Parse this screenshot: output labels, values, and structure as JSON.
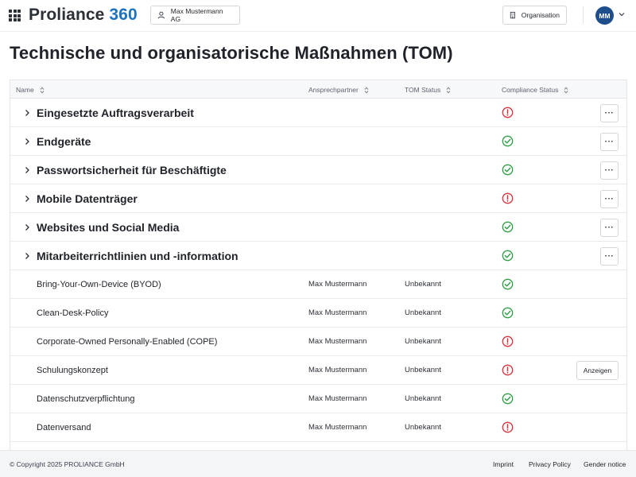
{
  "header": {
    "brand_name": "Proliance",
    "brand_suffix": "360",
    "tenant_label": "Max Mustermann AG",
    "org_label": "Organisation",
    "avatar_initials": "MM"
  },
  "page": {
    "title": "Technische und organisatorische Maßnahmen (TOM)"
  },
  "table": {
    "columns": {
      "name": "Name",
      "contact": "Ansprechpartner",
      "tom_status": "TOM Status",
      "compliance": "Compliance Status"
    },
    "more_label": "···",
    "view_label": "Anzeigen",
    "groups": [
      {
        "name": "Eingesetzte Auftragsverarbeit",
        "compliance": "warning"
      },
      {
        "name": "Endgeräte",
        "compliance": "ok"
      },
      {
        "name": "Passwortsicherheit für Beschäftigte",
        "compliance": "ok"
      },
      {
        "name": "Mobile Datenträger",
        "compliance": "warning"
      },
      {
        "name": "Websites und Social Media",
        "compliance": "ok"
      },
      {
        "name": "Mitarbeiterrichtlinien und -information",
        "compliance": "ok"
      }
    ],
    "items": [
      {
        "name": "Bring-Your-Own-Device (BYOD)",
        "contact": "Max Mustermann",
        "tom_status": "Unbekannt",
        "compliance": "ok"
      },
      {
        "name": "Clean-Desk-Policy",
        "contact": "Max Mustermann",
        "tom_status": "Unbekannt",
        "compliance": "ok"
      },
      {
        "name": "Corporate-Owned Personally-Enabled (COPE)",
        "contact": "Max Mustermann",
        "tom_status": "Unbekannt",
        "compliance": "warning"
      },
      {
        "name": "Schulungskonzept",
        "contact": "Max Mustermann",
        "tom_status": "Unbekannt",
        "compliance": "warning"
      },
      {
        "name": "Datenschutzverpflichtung",
        "contact": "Max Mustermann",
        "tom_status": "Unbekannt",
        "compliance": "ok"
      },
      {
        "name": "Datenversand",
        "contact": "Max Mustermann",
        "tom_status": "Unbekannt",
        "compliance": "warning"
      }
    ]
  },
  "footer": {
    "copyright": "© Copyright 2025 PROLIANCE GmbH",
    "imprint": "Imprint",
    "privacy": "Privacy Policy",
    "gender": "Gender notice"
  },
  "colors": {
    "brand": "#1e73be",
    "ok": "#2e9e44",
    "warning": "#d8313b",
    "avatar": "#1f4e8c"
  },
  "icons": {
    "ok": "check-circle-icon",
    "warning": "exclamation-circle-icon"
  }
}
